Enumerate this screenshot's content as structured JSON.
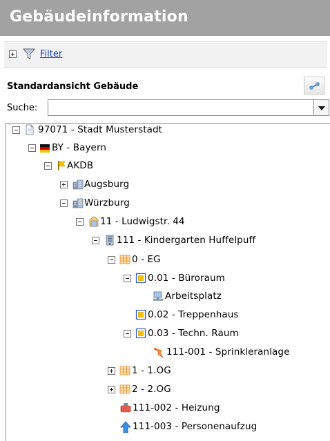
{
  "header": {
    "title": "Gebäudeinformation"
  },
  "filter": {
    "label": "Filter"
  },
  "view": {
    "title": "Standardansicht Gebäude"
  },
  "search": {
    "label": "Suche:",
    "value": ""
  },
  "tree": [
    {
      "label": "97071 - Stadt Musterstadt",
      "icon": "document-icon",
      "expanded": true
    },
    {
      "label": "BY - Bayern",
      "icon": "flag-germany-icon",
      "expanded": true
    },
    {
      "label": "AKDB",
      "icon": "flag-yellow-icon",
      "expanded": true
    },
    {
      "label": "Augsburg",
      "icon": "city-icon",
      "expanded": false
    },
    {
      "label": "Würzburg",
      "icon": "city-icon",
      "expanded": true
    },
    {
      "label": "11 - Ludwigstr. 44",
      "icon": "property-icon",
      "expanded": true
    },
    {
      "label": "111 - Kindergarten Huffelpuff",
      "icon": "building-icon",
      "expanded": true
    },
    {
      "label": "0 - EG",
      "icon": "floor-grid-icon",
      "expanded": true
    },
    {
      "label": "0.01 - Büroraum",
      "icon": "room-icon",
      "expanded": true
    },
    {
      "label": "Arbeitsplatz",
      "icon": "workstation-icon",
      "expanded": null
    },
    {
      "label": "0.02 - Treppenhaus",
      "icon": "room-icon",
      "expanded": null
    },
    {
      "label": "0.03 - Techn. Raum",
      "icon": "room-icon",
      "expanded": true
    },
    {
      "label": "111-001 - Sprinkleranlage",
      "icon": "sprinkler-icon",
      "expanded": null
    },
    {
      "label": "1 - 1.OG",
      "icon": "floor-grid-icon",
      "expanded": false
    },
    {
      "label": "2 - 2.OG",
      "icon": "floor-grid-icon",
      "expanded": false
    },
    {
      "label": "111-002 - Heizung",
      "icon": "heating-icon",
      "expanded": null
    },
    {
      "label": "111-003 - Personenaufzug",
      "icon": "elevator-arrow-icon",
      "expanded": null
    }
  ]
}
